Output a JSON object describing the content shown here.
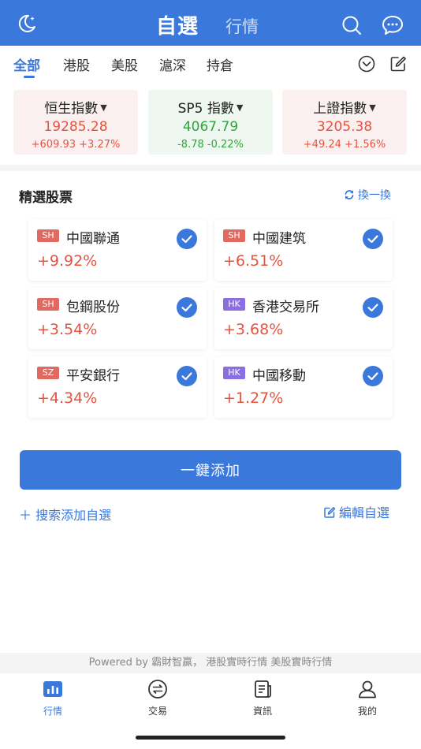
{
  "header": {
    "title": "自選",
    "subtitle": "行情"
  },
  "tabs": [
    "全部",
    "港股",
    "美股",
    "滬深",
    "持倉"
  ],
  "indices": [
    {
      "name": "恒生指數",
      "value": "19285.28",
      "change": "+609.93 +3.27%",
      "trend": "up"
    },
    {
      "name": "SP5 指數",
      "value": "4067.79",
      "change": "-8.78 -0.22%",
      "trend": "down"
    },
    {
      "name": "上證指數",
      "value": "3205.38",
      "change": "+49.24 +1.56%",
      "trend": "up"
    }
  ],
  "featured": {
    "title": "精選股票",
    "refresh_label": "換一換",
    "stocks": [
      {
        "market": "SH",
        "name": "中國聯通",
        "change": "+9.92%"
      },
      {
        "market": "SH",
        "name": "中國建筑",
        "change": "+6.51%"
      },
      {
        "market": "SH",
        "name": "包鋼股份",
        "change": "+3.54%"
      },
      {
        "market": "HK",
        "name": "香港交易所",
        "change": "+3.68%"
      },
      {
        "market": "SZ",
        "name": "平安銀行",
        "change": "+4.34%"
      },
      {
        "market": "HK",
        "name": "中國移動",
        "change": "+1.27%"
      }
    ]
  },
  "actions": {
    "add_all": "一鍵添加",
    "search_add": "＋ 搜索添加自選",
    "edit_watchlist": "編輯自選"
  },
  "footer": {
    "powered_by": "Powered by 霸財智贏， 港股實時行情 美股實時行情"
  },
  "nav": [
    "行情",
    "交易",
    "資訊",
    "我的"
  ],
  "colors": {
    "accent": "#3a78dc",
    "up": "#e5533f",
    "down": "#2fa53c",
    "market_sh_sz": "#e06a61",
    "market_hk": "#8b6fe0"
  }
}
